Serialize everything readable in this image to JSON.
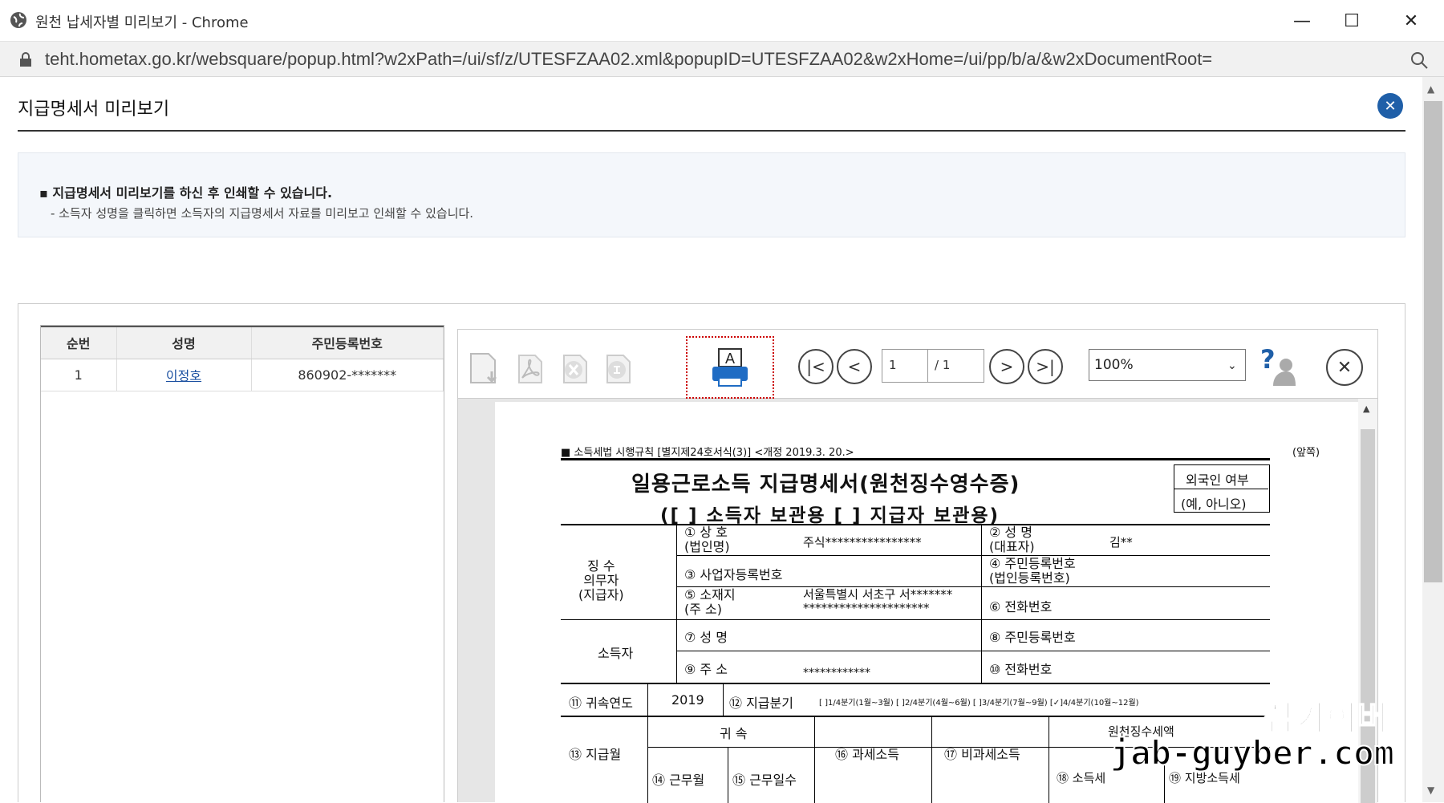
{
  "window": {
    "title": "원천 납세자별 미리보기 - Chrome",
    "url": "teht.hometax.go.kr/websquare/popup.html?w2xPath=/ui/sf/z/UTESFZAA02.xml&popupID=UTESFZAA02&w2xHome=/ui/pp/b/a/&w2xDocumentRoot=",
    "minimize": "—",
    "maximize": "☐",
    "close": "✕"
  },
  "popup": {
    "title": "지급명세서 미리보기",
    "close": "✕"
  },
  "notice": {
    "line1": "▪ 지급명세서 미리보기를 하신 후 인쇄할 수 있습니다.",
    "line2": "- 소득자 성명을 클릭하면 소득자의 지급명세서 자료를 미리보고 인쇄할 수 있습니다."
  },
  "list": {
    "headers": [
      "순번",
      "성명",
      "주민등록번호"
    ],
    "rows": [
      {
        "no": "1",
        "name": "이정호",
        "rrn": "860902-*******"
      }
    ]
  },
  "viewer": {
    "page_current": "1",
    "page_total": "/ 1",
    "zoom": "100%",
    "print_letter": "A",
    "first": "|<",
    "prev": "<",
    "next": ">",
    "last": ">|",
    "help": "?",
    "close": "✕"
  },
  "doc": {
    "rule": "■ 소득세법 시행규칙 [별지제24호서식(3)] <개정 2019.3. 20.>",
    "side": "(앞쪽)",
    "title": "일용근로소득 지급명세서(원천징수영수증)",
    "subtitle": "([ ] 소득자 보관용 [ ] 지급자 보관용)",
    "foreign_label": "외국인 여부",
    "foreign_value": "(예, 아니오)",
    "group1": "징 수\n의무자\n(지급자)",
    "group2": "소득자",
    "f1": "① 상 호\n(법인명)",
    "v1": "주식****************",
    "f2": "② 성 명\n(대표자)",
    "v2": "김**",
    "f3": "③ 사업자등록번호",
    "f4": "④ 주민등록번호\n(법인등록번호)",
    "f5": "⑤ 소재지\n(주 소)",
    "v5": "서울특별시 서초구 서*******\n*********************",
    "f6": "⑥ 전화번호",
    "f7": "⑦ 성 명",
    "f8": "⑧ 주민등록번호",
    "f9": "⑨ 주 소",
    "v9": "************",
    "f10": "⑩ 전화번호",
    "f11": "⑪ 귀속연도",
    "v11": "2019",
    "f12": "⑫ 지급분기",
    "quarters": "[ ]1/4분기(1월~3월) [ ]2/4분기(4월~6월) [ ]3/4분기(7월~9월) [✓]4/4분기(10월~12월)",
    "h13": "⑬ 지급월",
    "h_gwi": "귀 속",
    "h14": "⑭ 근무월",
    "h15": "⑮ 근무일수",
    "h16": "⑯ 과세소득",
    "h17": "⑰ 비과세소득",
    "h_tax": "원천징수세액",
    "h18": "⑱ 소득세",
    "h19": "⑲ 지방소득세"
  },
  "watermark": {
    "line1": "잡가이버",
    "line2": "jab-guyber.com"
  }
}
